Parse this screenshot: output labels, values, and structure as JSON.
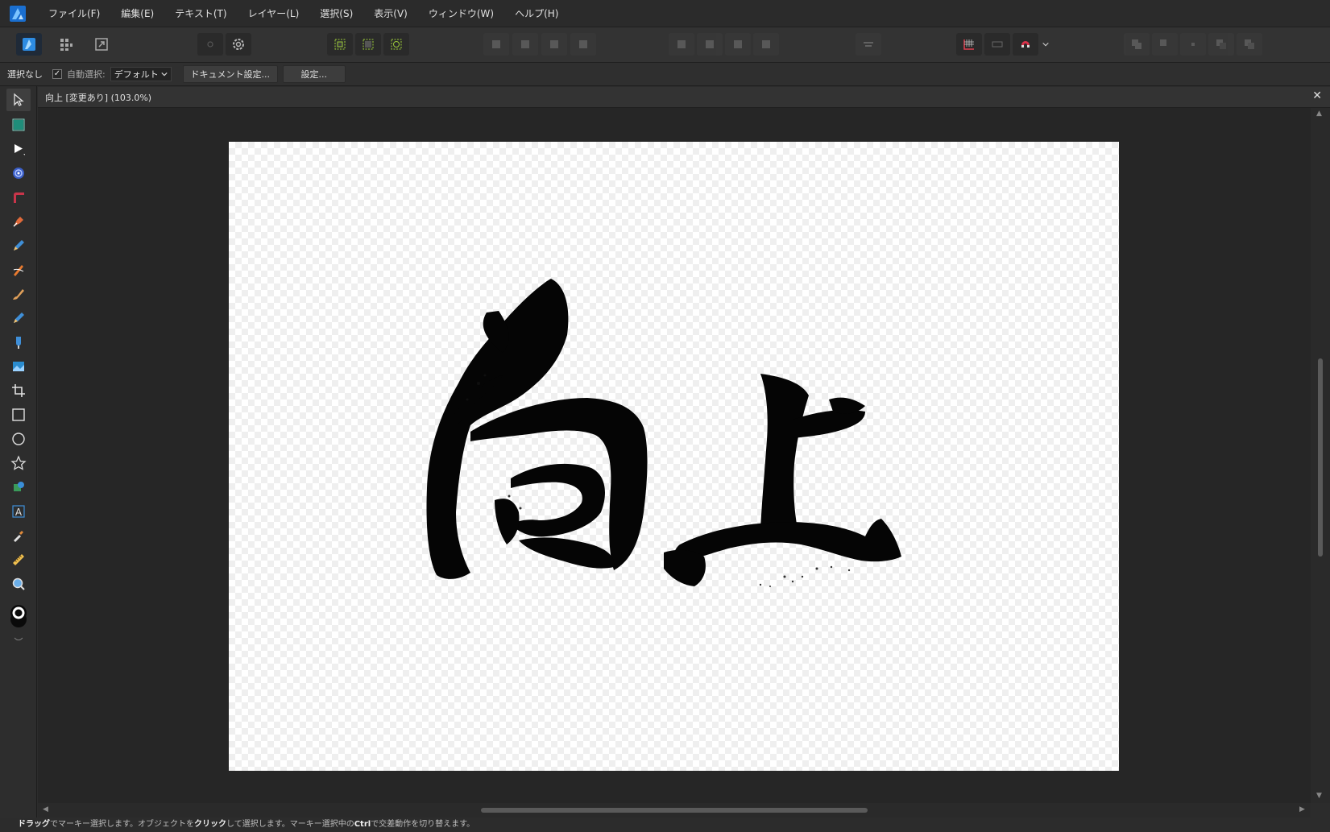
{
  "menubar": {
    "items": [
      "ファイル(F)",
      "編集(E)",
      "テキスト(T)",
      "レイヤー(L)",
      "選択(S)",
      "表示(V)",
      "ウィンドウ(W)",
      "ヘルプ(H)"
    ]
  },
  "contextbar": {
    "selection_status": "選択なし",
    "auto_select_label": "自動選択:",
    "auto_select_checked": true,
    "auto_select_value": "デフォルト",
    "document_setup_label": "ドキュメント設定...",
    "preferences_label": "設定..."
  },
  "document": {
    "tab_title": "向上 [変更あり] (103.0%)",
    "close_icon": "close-icon"
  },
  "status": {
    "drag_word": "ドラッグ",
    "text1": "でマーキー選択します。オブジェクトを",
    "click_word": "クリック",
    "text2": "して選択します。マーキー選択中の",
    "ctrl_word": "Ctrl",
    "text3": "で交差動作を切り替えます。"
  },
  "colors": {
    "accent": "#2d8ce3",
    "snapping_magnet": "#d8324a",
    "canvas_bg": "#262626"
  }
}
